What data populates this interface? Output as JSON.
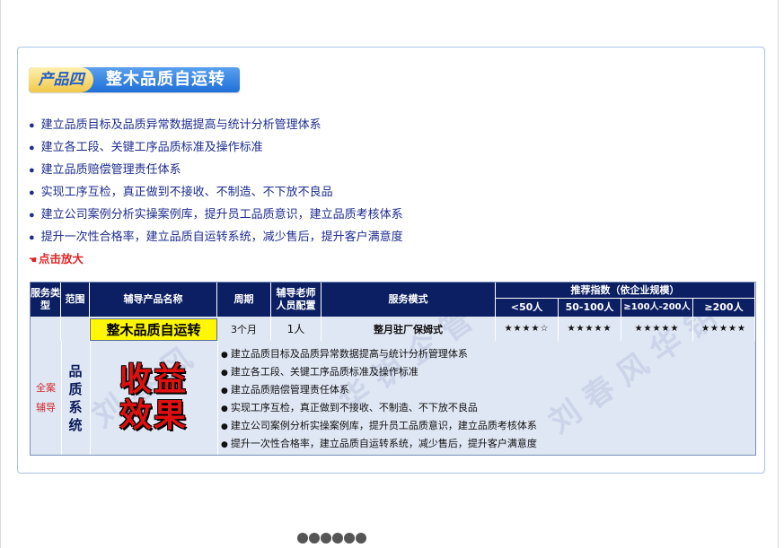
{
  "banner": {
    "tag": "产品四",
    "title": "整木品质自运转"
  },
  "bullets": [
    "建立品质目标及品质异常数据提高与统计分析管理体系",
    "建立各工段、关键工序品质标准及操作标准",
    "建立品质赔偿管理责任体系",
    "实现工序互检，真正做到不接收、不制造、不下放不良品",
    "建立公司案例分析实操案例库，提升员工品质意识，建立品质考核体系",
    "提升一次性合格率，建立品质自运转系统，减少售后，提升客户满意度"
  ],
  "zoom_link": "点击放大",
  "table": {
    "headers": {
      "service_type": "服务类型",
      "scope": "范围",
      "product_name": "辅导产品名称",
      "period": "周期",
      "staff": "辅导老师人员配置",
      "mode": "服务模式",
      "recommend": "推荐指数（依企业规模）",
      "sizes": [
        "<50人",
        "50-100人",
        "≥100人-200人",
        "≥200人"
      ]
    },
    "row": {
      "product_name": "整木品质自运转",
      "period": "3个月",
      "staff": "1人",
      "mode": "整月驻厂保姆式",
      "ratings": [
        "★★★★☆",
        "★★★★★",
        "★★★★★",
        "★★★★★"
      ]
    },
    "service_type_value": "全案辅导",
    "system_label": "品质系统",
    "effect_lines": [
      "收益",
      "效果"
    ],
    "details": [
      "建立品质目标及品质异常数据提高与统计分析管理体系",
      "建立各工段、关键工序品质标准及操作标准",
      "建立品质赔偿管理责任体系",
      "实现工序互检，真正做到不接收、不制造、不下放不良品",
      "建立公司案例分析实操案例库，提升员工品质意识，建立品质考核体系",
      "提升一次性合格率，建立品质自运转系统，减少售后，提升客户满意度"
    ]
  },
  "colors": {
    "header_bg": "#0c1f63",
    "banner_blue": "#1f6fd8",
    "highlight_yellow": "#fff700",
    "accent_red": "#e01010"
  }
}
